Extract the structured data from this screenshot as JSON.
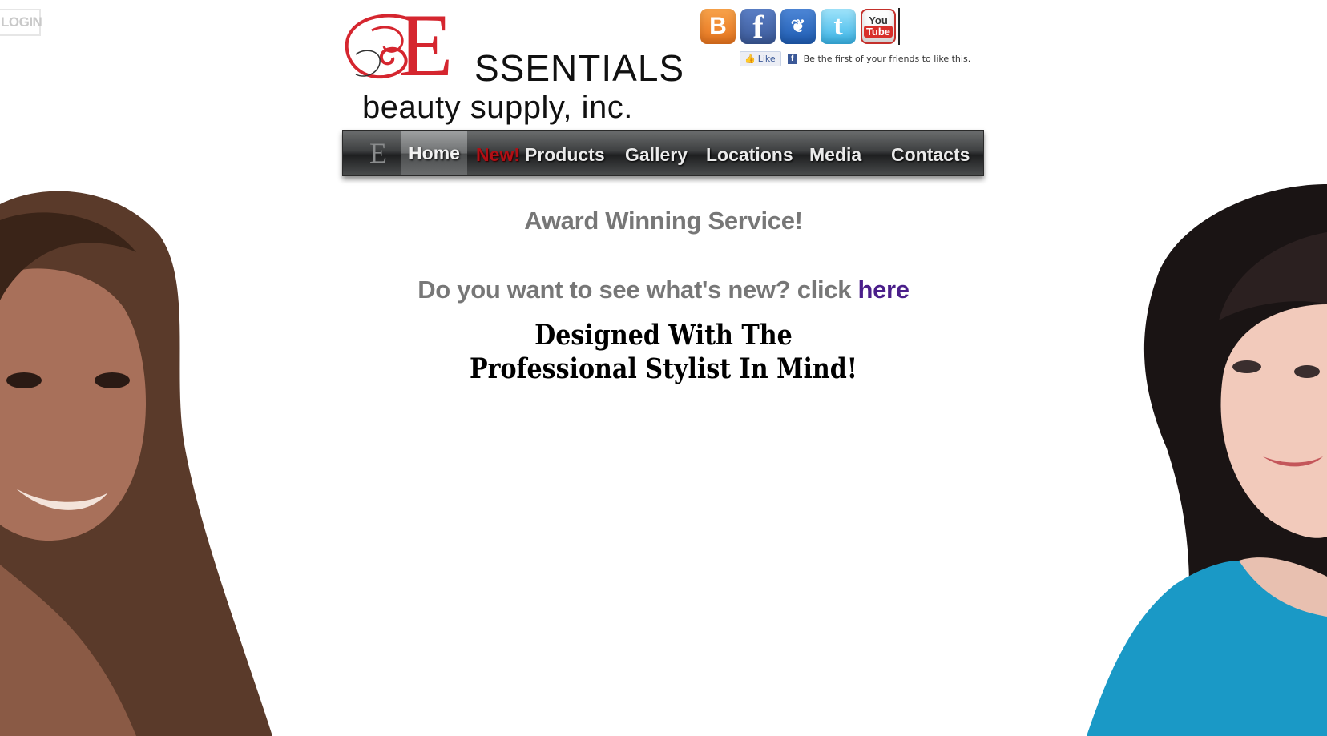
{
  "login": {
    "label": "LOGIN"
  },
  "logo": {
    "letter": "E",
    "word": "SSENTIALS",
    "sub": "beauty supply, inc."
  },
  "social": {
    "blogger_glyph": "B",
    "facebook_glyph": "f",
    "myspace_glyph": "❦",
    "twitter_glyph": "t",
    "youtube_you": "You",
    "youtube_tube": "Tube"
  },
  "facebook_like": {
    "button_label": "Like",
    "text": "Be the first of your friends to like this."
  },
  "nav": {
    "logo_glyph": "E",
    "items": [
      {
        "label": "Home"
      },
      {
        "label": "Products",
        "badge": "New!"
      },
      {
        "label": "Gallery"
      },
      {
        "label": "Locations"
      },
      {
        "label": "Media"
      },
      {
        "label": "Contacts"
      }
    ]
  },
  "main": {
    "headline": "Award Winning Service!",
    "question": "Do you want to see what's new? click",
    "link": "here",
    "tagline": "Designed With The Professional Stylist In Mind!"
  },
  "colors": {
    "logo_red": "#d5262f",
    "nav_new_red": "#b10f15",
    "link_purple": "#4a1e8a",
    "heading_gray": "#777777"
  },
  "icons": [
    "blogger-icon",
    "facebook-icon",
    "myspace-icon",
    "twitter-icon",
    "youtube-icon"
  ]
}
